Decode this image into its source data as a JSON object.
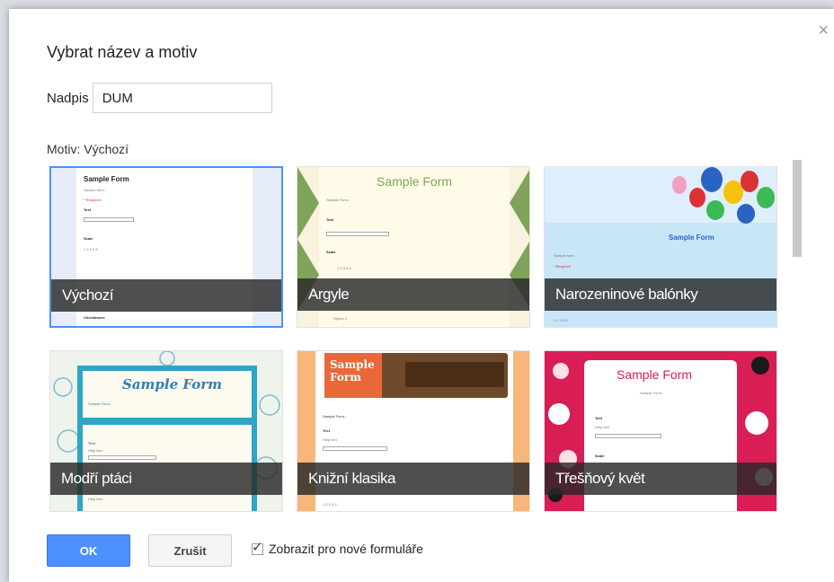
{
  "dialog": {
    "title": "Vybrat název a motiv",
    "close_glyph": "×",
    "name_label": "Nadpis",
    "name_value": "DUM",
    "theme_label": "Motiv: Výchozí"
  },
  "themes": [
    {
      "label": "Výchozí",
      "selected": true
    },
    {
      "label": "Argyle",
      "selected": false
    },
    {
      "label": "Narozeninové balónky",
      "selected": false
    },
    {
      "label": "Modří ptáci",
      "selected": false
    },
    {
      "label": "Knižní klasika",
      "selected": false
    },
    {
      "label": "Třešňový květ",
      "selected": false
    }
  ],
  "previews": {
    "sample_form": "Sample Form",
    "sample_form_stacked": [
      "Sample",
      "Form"
    ],
    "sample_text": "Sample form...",
    "sample_text_alt": "Sample Form...",
    "required": "* Required",
    "text_label": "Text",
    "help_text": "Help text",
    "scale_label": "Scale",
    "checkboxes_label": "Checkboxes",
    "option1": "Option 1",
    "option2": "Option 2",
    "scale_numbers": "1   2   3   4   5"
  },
  "buttons": {
    "ok": "OK",
    "cancel": "Zrušit"
  },
  "checkbox": {
    "label": "Zobrazit pro nové formuláře",
    "checked": true,
    "mark": "✓"
  },
  "colors": {
    "accent": "#4d90fe",
    "selected_border": "#4d90fe",
    "caption_bg": "#282828"
  }
}
